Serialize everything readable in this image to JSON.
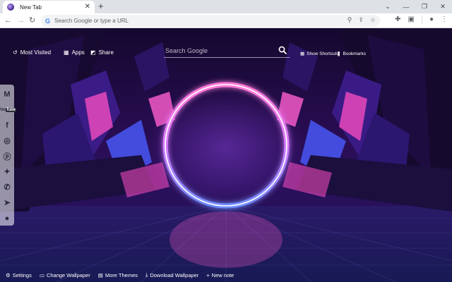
{
  "browser": {
    "tab_title": "New Tab",
    "tab_close": "✕",
    "new_tab": "+",
    "window_controls": [
      "⌄",
      "—",
      "❐",
      "✕"
    ],
    "nav": {
      "back": "←",
      "forward": "→",
      "reload": "↻"
    },
    "omnibox_placeholder": "Search Google or type a URL",
    "omnibox_icons": [
      "zoom-icon",
      "share-icon",
      "star-icon"
    ],
    "toolbar_icons": [
      "extensions-icon",
      "sidepanel-icon",
      "profile-icon",
      "menu-icon"
    ]
  },
  "page": {
    "top_links": {
      "most_visited": "Most Visited",
      "apps": "Apps",
      "share": "Share"
    },
    "search": {
      "placeholder": "Search Google"
    },
    "shortcuts": {
      "show_shortcuts": "Show Shortcuts",
      "bookmarks": "Bookmarks"
    },
    "social_icons": [
      "gmail-icon",
      "youtube-icon",
      "facebook-icon",
      "instagram-icon",
      "pinterest-icon",
      "twitter-icon",
      "whatsapp-icon",
      "telegram-icon",
      "reddit-icon"
    ],
    "bottom_bar": {
      "settings": "Settings",
      "change_wallpaper": "Change Wallpaper",
      "more_themes": "More Themes",
      "download_wallpaper": "Download Wallpaper",
      "new_note": "New note"
    }
  },
  "colors": {
    "ring_glow": "#ff6ad5",
    "ring_core": "#ffffff",
    "ring_blue": "#6f8dff",
    "crystal_dark": "#150a2e",
    "crystal_pink": "#ff4fc4",
    "crystal_blue": "#4a5cff"
  }
}
